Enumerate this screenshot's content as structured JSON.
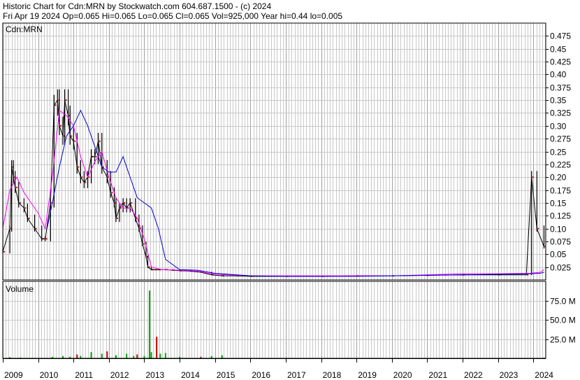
{
  "header": {
    "line1": "Historic Chart for Cdn:MRN by Stockwatch.com 604.687.1500 - (c) 2024",
    "line2": "Fri Apr 19 2024   Op=0.065  Hi=0.065  Lo=0.065  Cl=0.065  Vol=925,000  Year hi=0.44  lo=0.005"
  },
  "colors": {
    "grid": "#c8c8c8",
    "price_bar": "#000000",
    "up_tick": "#cc0000",
    "ma_short": "#ff00ff",
    "ma_long": "#0000cc",
    "volume_bar": "#00aa00",
    "volume_down_bar": "#cc0000"
  },
  "chart_data": [
    {
      "type": "line",
      "title": "Cdn:MRN",
      "ylim": [
        0,
        0.5
      ],
      "yticks": [
        0.025,
        0.05,
        0.075,
        0.1,
        0.125,
        0.15,
        0.175,
        0.2,
        0.225,
        0.25,
        0.275,
        0.3,
        0.325,
        0.35,
        0.375,
        0.4,
        0.425,
        0.45,
        0.475
      ],
      "ytick_labels": [
        "0.025",
        "0.05",
        "0.075",
        "0.10",
        "0.125",
        "0.15",
        "0.175",
        "0.20",
        "0.225",
        "0.25",
        "0.275",
        "0.30",
        "0.325",
        "0.35",
        "0.375",
        "0.40",
        "0.425",
        "0.45",
        "0.475"
      ],
      "xlim": [
        2009.0,
        2024.35
      ],
      "x_years": [
        2009,
        2010,
        2011,
        2012,
        2013,
        2014,
        2015,
        2016,
        2017,
        2018,
        2019,
        2020,
        2021,
        2022,
        2023,
        2024
      ],
      "grid": true,
      "series": [
        {
          "kind": "price",
          "x": [
            2009.0,
            2009.2,
            2009.25,
            2009.3,
            2009.35,
            2009.45,
            2009.6,
            2009.7,
            2009.9,
            2010.1,
            2010.2,
            2010.35,
            2010.45,
            2010.55,
            2010.6,
            2010.7,
            2010.75,
            2010.85,
            2010.9,
            2011.0,
            2011.1,
            2011.2,
            2011.3,
            2011.4,
            2011.5,
            2011.6,
            2011.7,
            2011.8,
            2011.95,
            2012.05,
            2012.15,
            2012.2,
            2012.3,
            2012.4,
            2012.5,
            2012.6,
            2012.75,
            2012.85,
            2012.95,
            2013.05,
            2013.1,
            2013.2,
            2013.3,
            2013.4,
            2013.6,
            2013.8,
            2014.0,
            2014.3,
            2014.6,
            2014.9,
            2015.2,
            2015.6,
            2016.0,
            2017.0,
            2018.0,
            2019.0,
            2020.0,
            2021.0,
            2022.0,
            2023.0,
            2023.8,
            2023.95,
            2024.1,
            2024.3
          ],
          "values": [
            0.055,
            0.1,
            0.22,
            0.2,
            0.18,
            0.15,
            0.14,
            0.12,
            0.1,
            0.08,
            0.08,
            0.15,
            0.34,
            0.35,
            0.3,
            0.28,
            0.35,
            0.32,
            0.28,
            0.27,
            0.22,
            0.2,
            0.19,
            0.2,
            0.24,
            0.24,
            0.27,
            0.22,
            0.2,
            0.17,
            0.15,
            0.12,
            0.14,
            0.15,
            0.14,
            0.15,
            0.12,
            0.1,
            0.07,
            0.045,
            0.025,
            0.02,
            0.02,
            0.02,
            0.02,
            0.019,
            0.018,
            0.017,
            0.015,
            0.01,
            0.008,
            0.008,
            0.007,
            0.007,
            0.007,
            0.008,
            0.008,
            0.009,
            0.01,
            0.01,
            0.01,
            0.2,
            0.1,
            0.065
          ]
        },
        {
          "kind": "ma_short",
          "x": [
            2009.0,
            2009.2,
            2009.4,
            2009.6,
            2009.8,
            2010.0,
            2010.2,
            2010.4,
            2010.6,
            2010.8,
            2011.0,
            2011.2,
            2011.4,
            2011.6,
            2011.8,
            2012.0,
            2012.2,
            2012.4,
            2012.6,
            2012.8,
            2013.0,
            2013.2,
            2013.5,
            2014.0,
            2014.5,
            2015.0,
            2016.0,
            2017.0,
            2018.0,
            2019.0,
            2020.0,
            2021.0,
            2022.0,
            2023.0,
            2023.9,
            2024.2,
            2024.3
          ],
          "values": [
            0.1,
            0.175,
            0.2,
            0.17,
            0.15,
            0.13,
            0.1,
            0.2,
            0.33,
            0.32,
            0.3,
            0.24,
            0.2,
            0.23,
            0.25,
            0.2,
            0.16,
            0.14,
            0.14,
            0.12,
            0.08,
            0.025,
            0.02,
            0.019,
            0.017,
            0.011,
            0.008,
            0.008,
            0.008,
            0.008,
            0.008,
            0.01,
            0.012,
            0.012,
            0.013,
            0.015,
            0.02
          ]
        },
        {
          "kind": "ma_long",
          "x": [
            2010.25,
            2010.4,
            2010.6,
            2010.8,
            2011.0,
            2011.2,
            2011.4,
            2011.6,
            2011.8,
            2012.0,
            2012.2,
            2012.4,
            2012.6,
            2012.8,
            2013.0,
            2013.2,
            2013.4,
            2013.6,
            2014.0,
            2014.5,
            2015.0,
            2016.0,
            2017.0,
            2018.0,
            2019.0,
            2020.0,
            2021.0,
            2022.0,
            2023.0,
            2023.9,
            2024.2,
            2024.3
          ],
          "values": [
            0.1,
            0.15,
            0.22,
            0.28,
            0.3,
            0.33,
            0.3,
            0.26,
            0.22,
            0.21,
            0.21,
            0.24,
            0.2,
            0.16,
            0.15,
            0.14,
            0.1,
            0.04,
            0.02,
            0.019,
            0.013,
            0.008,
            0.007,
            0.007,
            0.007,
            0.008,
            0.009,
            0.01,
            0.011,
            0.012,
            0.013,
            0.015
          ]
        }
      ]
    },
    {
      "type": "bar",
      "title": "Volume",
      "ylim": [
        0,
        100
      ],
      "yticks": [
        25,
        50,
        75
      ],
      "ytick_labels": [
        "25.0 M",
        "50.0 M",
        "75.0 M"
      ],
      "x_years": [
        2009,
        2010,
        2011,
        2012,
        2013,
        2014,
        2015,
        2016,
        2017,
        2018,
        2019,
        2020,
        2021,
        2022,
        2023,
        2024
      ],
      "x": [
        2009.2,
        2009.5,
        2009.8,
        2010.1,
        2010.4,
        2010.7,
        2010.9,
        2011.1,
        2011.2,
        2011.5,
        2011.8,
        2011.95,
        2012.2,
        2012.5,
        2012.7,
        2012.8,
        2013.0,
        2013.15,
        2013.2,
        2013.35,
        2013.45,
        2013.6,
        2014.0,
        2014.6,
        2014.9,
        2015.2,
        2024.3
      ],
      "values": [
        1.5,
        1,
        0.5,
        0.5,
        2,
        3,
        2,
        5,
        3,
        8,
        6,
        9,
        4,
        6,
        3,
        5,
        3,
        88,
        8,
        28,
        6,
        7,
        2,
        2,
        3,
        4,
        0.9
      ]
    }
  ]
}
